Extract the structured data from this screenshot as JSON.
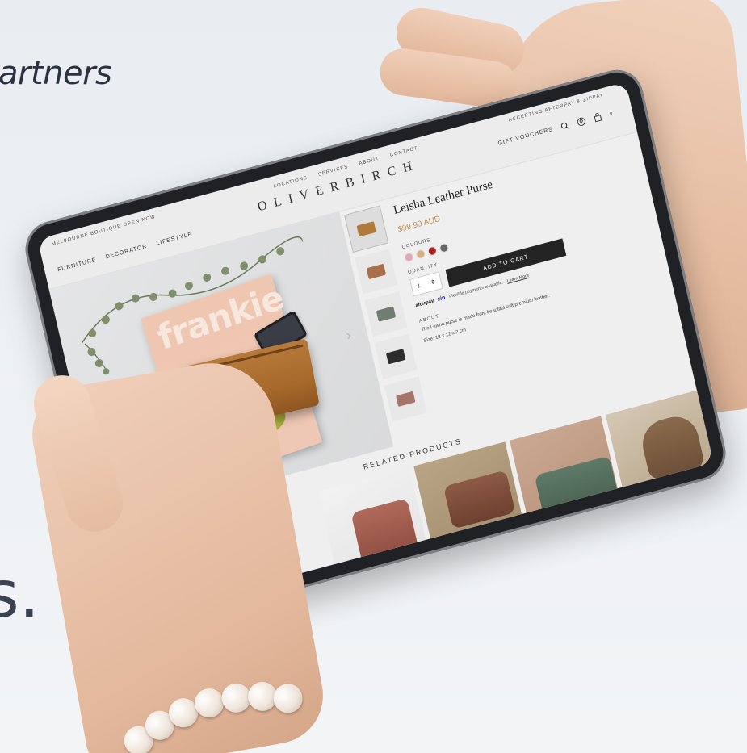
{
  "background": {
    "top_text": "artners",
    "bottom_text": "s."
  },
  "store": {
    "announcement": "MELBOURNE BOUTIQUE OPEN NOW",
    "accepting": "ACCEPTING AFTERPAY & ZIPPAY",
    "top_links": [
      "LOCATIONS",
      "SERVICES",
      "ABOUT",
      "CONTACT"
    ],
    "logo": "OLIVERBIRCH",
    "main_nav": [
      "FURNITURE",
      "DECORATOR",
      "LIFESTYLE"
    ],
    "gift_vouchers": "GIFT VOUCHERS",
    "cart_count": "0"
  },
  "gallery": {
    "magazine_title": "frankie",
    "next_arrow": "›",
    "dots": 5,
    "active_dot": 0
  },
  "product": {
    "title": "Leisha Leather Purse",
    "price": "$99.99 AUD",
    "colours_label": "COLOURS",
    "colours": [
      "#e7a6b5",
      "#d7b17d",
      "#a82222",
      "#666666"
    ],
    "quantity_label": "QUANTITY",
    "quantity": "1",
    "add_to_cart": "ADD TO CART",
    "afterpay": "afterpay",
    "zip": "zip",
    "payment_note": "Flexible payments available.",
    "learn_more": "Learn More",
    "about_label": "ABOUT",
    "about_text": "The Leisha purse is made from beautiful soft premium leather.",
    "size_text": "Size: 18 x 12 x 2 cm"
  },
  "thumbnail_colours": [
    "#b07a3a",
    "#a86f4a",
    "#6e7e70",
    "#2c2c2c",
    "#a6756a"
  ],
  "related": {
    "title": "RELATED PRODUCTS"
  }
}
